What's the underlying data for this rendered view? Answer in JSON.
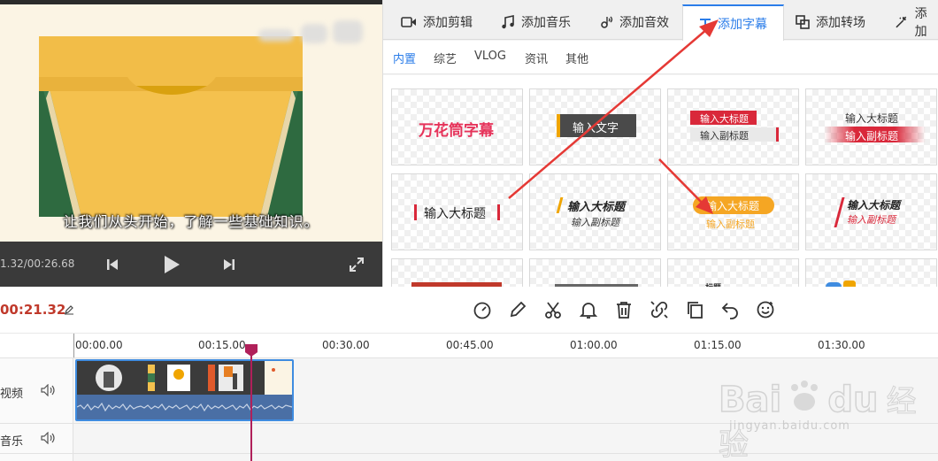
{
  "preview": {
    "subtitle": "让我们从头开始，了解一些基础知识。",
    "time_readout": "1.32/00:26.68"
  },
  "tabs": [
    {
      "label": "添加剪辑",
      "icon": "video-icon"
    },
    {
      "label": "添加音乐",
      "icon": "music-note-icon"
    },
    {
      "label": "添加音效",
      "icon": "sound-effect-icon"
    },
    {
      "label": "添加字幕",
      "icon": "text-icon",
      "active": true
    },
    {
      "label": "添加转场",
      "icon": "transition-icon"
    },
    {
      "label": "添加",
      "icon": "effect-icon"
    }
  ],
  "subtabs": [
    {
      "label": "内置",
      "active": true
    },
    {
      "label": "综艺"
    },
    {
      "label": "VLOG"
    },
    {
      "label": "资讯"
    },
    {
      "label": "其他"
    }
  ],
  "cards": {
    "c1": {
      "title": "万花筒字幕"
    },
    "c2": {
      "title": "输入文字"
    },
    "c3": {
      "title": "输入大标题",
      "sub": "输入副标题"
    },
    "c4": {
      "title": "输入大标题",
      "sub": "输入副标题"
    },
    "c5": {
      "title": "输入大标题"
    },
    "c6": {
      "title": "输入大标题",
      "sub": "输入副标题"
    },
    "c7": {
      "title": "输入大标题",
      "sub": "输入副标题"
    },
    "c8": {
      "title": "输入大标题",
      "sub": "输入副标题"
    },
    "c11": {
      "title": "标题"
    }
  },
  "timeline": {
    "current_time": "00:21.32",
    "ticks": [
      "00:00.00",
      "00:15.00",
      "00:30.00",
      "00:45.00",
      "01:00.00",
      "01:15.00",
      "01:30.00"
    ],
    "tracks": {
      "video": "视频",
      "music": "音乐"
    }
  },
  "tools": [
    "speed-icon",
    "pencil-icon",
    "scissors-icon",
    "bell-icon",
    "trash-icon",
    "detach-icon",
    "copy-icon",
    "undo-icon",
    "emoji-icon"
  ],
  "watermark": {
    "brand": "Bai",
    "brand2": "du",
    "cn": "经验",
    "url": "jingyan.baidu.com"
  },
  "colors": {
    "accent": "#2b7de9",
    "time_red": "#c0392b",
    "playhead": "#b0205a",
    "arrow": "#e53935"
  }
}
